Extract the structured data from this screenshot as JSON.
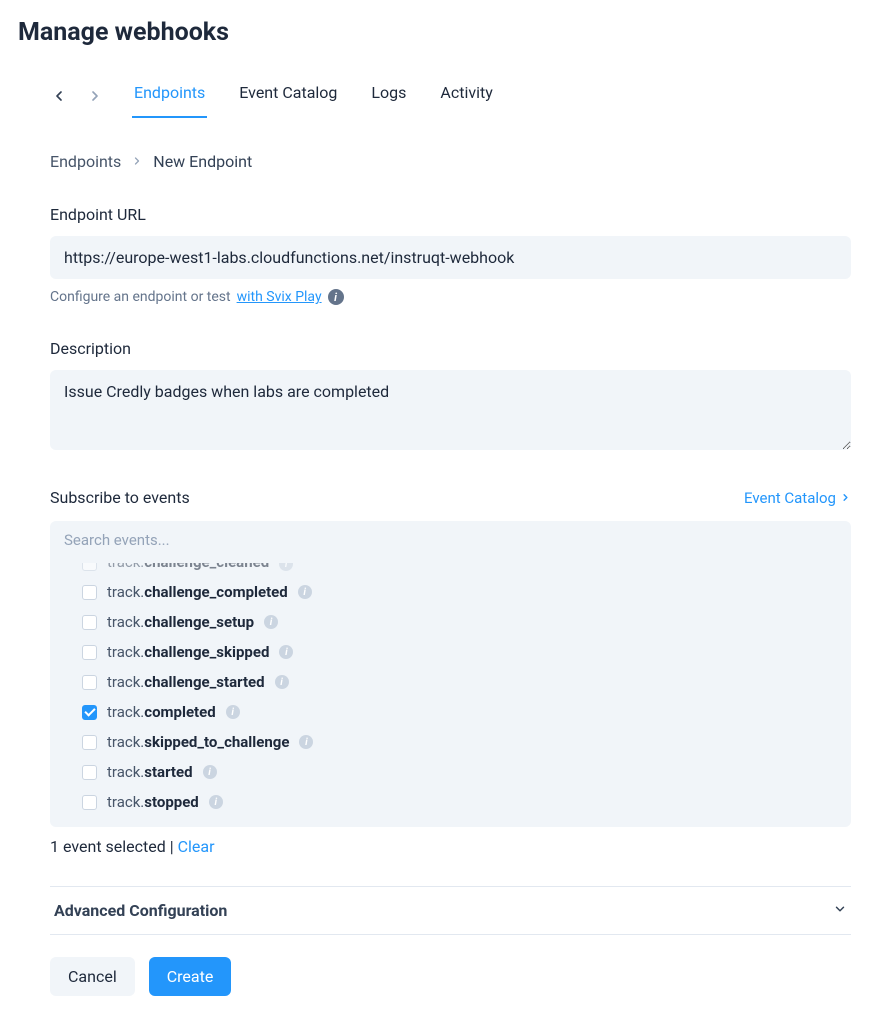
{
  "title": "Manage webhooks",
  "tabs": {
    "endpoints": "Endpoints",
    "event_catalog": "Event Catalog",
    "logs": "Logs",
    "activity": "Activity",
    "active": "endpoints"
  },
  "breadcrumb": {
    "root": "Endpoints",
    "current": "New Endpoint"
  },
  "form": {
    "url_label": "Endpoint URL",
    "url_value": "https://europe-west1-labs.cloudfunctions.net/instruqt-webhook",
    "hint_prefix": "Configure an endpoint or test ",
    "hint_link": "with Svix Play",
    "description_label": "Description",
    "description_value": "Issue Credly badges when labs are completed",
    "subscribe_label": "Subscribe to events",
    "catalog_link": "Event Catalog",
    "search_placeholder": "Search events...",
    "selected_text": "1 event selected | ",
    "clear": "Clear",
    "advanced": "Advanced Configuration",
    "cancel": "Cancel",
    "create": "Create"
  },
  "events": [
    {
      "prefix": "track.",
      "name": "challenge_cleaned",
      "checked": false,
      "cut": true
    },
    {
      "prefix": "track.",
      "name": "challenge_completed",
      "checked": false
    },
    {
      "prefix": "track.",
      "name": "challenge_setup",
      "checked": false
    },
    {
      "prefix": "track.",
      "name": "challenge_skipped",
      "checked": false
    },
    {
      "prefix": "track.",
      "name": "challenge_started",
      "checked": false
    },
    {
      "prefix": "track.",
      "name": "completed",
      "checked": true
    },
    {
      "prefix": "track.",
      "name": "skipped_to_challenge",
      "checked": false
    },
    {
      "prefix": "track.",
      "name": "started",
      "checked": false
    },
    {
      "prefix": "track.",
      "name": "stopped",
      "checked": false
    }
  ]
}
